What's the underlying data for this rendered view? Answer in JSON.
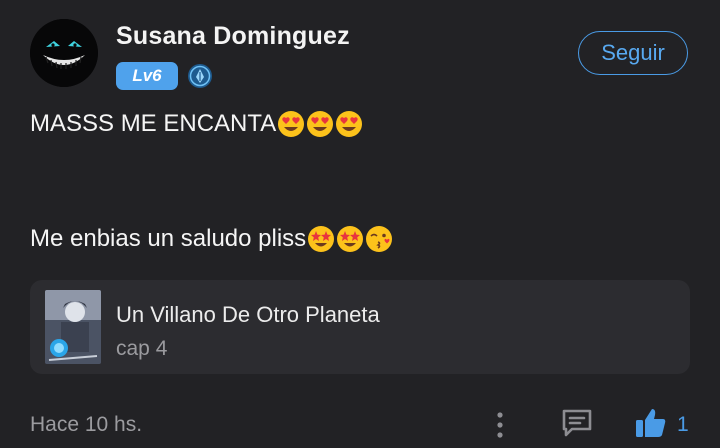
{
  "user": {
    "name": "Susana Dominguez",
    "level": "Lv6",
    "avatar_icon": "cheshire-cat-grin-avatar",
    "verified_icon": "quill-badge-icon"
  },
  "actions": {
    "follow_label": "Seguir"
  },
  "comment": {
    "line1_text": "MASSS ME ENCANTA",
    "line1_emojis": [
      "heart-eyes",
      "heart-eyes",
      "heart-eyes"
    ],
    "line2_text": "Me enbias un saludo pliss",
    "line2_emojis": [
      "star-struck",
      "star-struck",
      "kissing-face"
    ]
  },
  "book": {
    "title": "Un Villano De Otro Planeta",
    "chapter": "cap 4"
  },
  "footer": {
    "timestamp": "Hace 10 hs.",
    "like_count": "1",
    "icons": [
      "more-vertical-icon",
      "reply-icon",
      "thumbs-up-icon"
    ]
  },
  "colors": {
    "background": "#222225",
    "accent": "#4a9be6",
    "card": "#2c2c30",
    "badge": "#4fa2ec"
  }
}
